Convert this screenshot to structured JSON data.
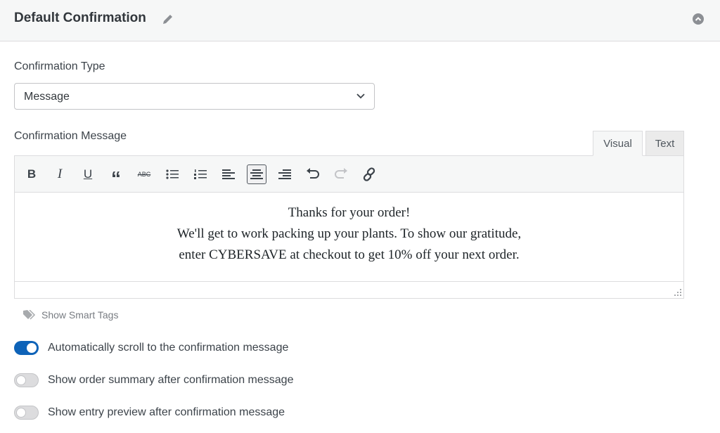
{
  "header": {
    "title": "Default Confirmation",
    "edit_icon": "pencil-icon",
    "collapse_icon": "chevron-up-circle-icon"
  },
  "confirmation_type": {
    "label": "Confirmation Type",
    "value": "Message"
  },
  "confirmation_message": {
    "label": "Confirmation Message",
    "tabs": [
      {
        "label": "Visual",
        "active": true
      },
      {
        "label": "Text",
        "active": false
      }
    ],
    "toolbar": [
      "bold",
      "italic",
      "underline",
      "blockquote",
      "strikethrough",
      "bulleted-list",
      "numbered-list",
      "align-left",
      "align-center",
      "align-right",
      "undo",
      "redo",
      "link"
    ],
    "toolbar_text": {
      "bold": "B",
      "italic": "I",
      "underline": "U",
      "quote": "“",
      "strike": "ABC"
    },
    "lines": [
      "Thanks for your order!",
      "We'll get to work packing up your plants. To show our gratitude,",
      "enter CYBERSAVE at checkout to get 10% off your next order."
    ]
  },
  "smart_tags": {
    "label": "Show Smart Tags"
  },
  "toggles": [
    {
      "label": "Automatically scroll to the confirmation message",
      "on": true
    },
    {
      "label": "Show order summary after confirmation message",
      "on": false
    },
    {
      "label": "Show entry preview after confirmation message",
      "on": false
    }
  ],
  "colors": {
    "accent": "#0e63b8"
  }
}
